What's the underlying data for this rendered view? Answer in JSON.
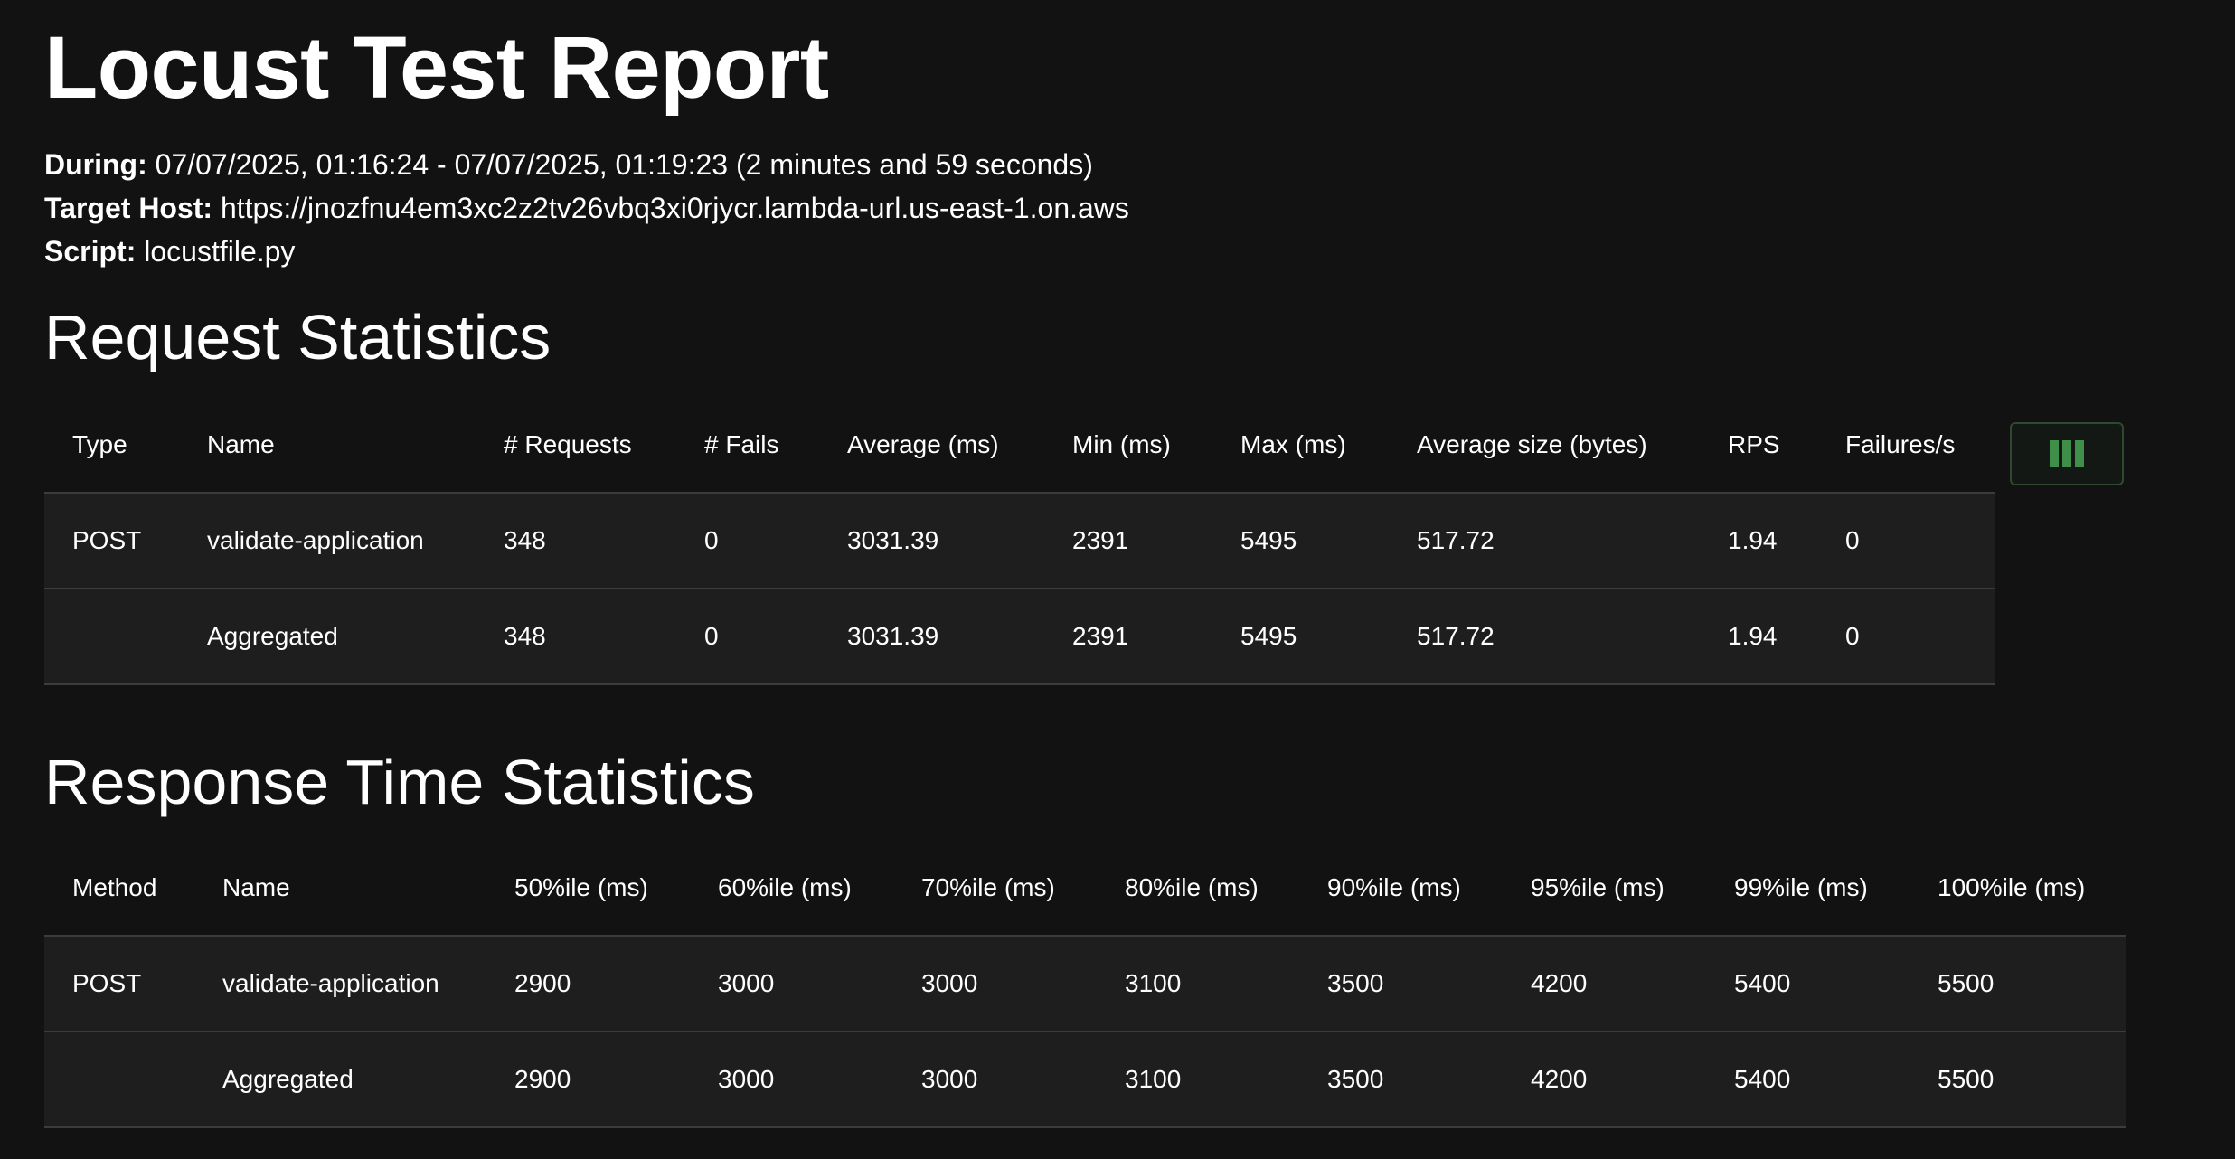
{
  "title": "Locust Test Report",
  "meta": {
    "during_label": "During:",
    "during_value": "07/07/2025, 01:16:24 - 07/07/2025, 01:19:23 (2 minutes and 59 seconds)",
    "host_label": "Target Host:",
    "host_value": "https://jnozfnu4em3xc2z2tv26vbq3xi0rjycr.lambda-url.us-east-1.on.aws",
    "script_label": "Script:",
    "script_value": "locustfile.py"
  },
  "request_statistics": {
    "title": "Request Statistics",
    "columns": [
      "Type",
      "Name",
      "# Requests",
      "# Fails",
      "Average (ms)",
      "Min (ms)",
      "Max (ms)",
      "Average size (bytes)",
      "RPS",
      "Failures/s"
    ],
    "rows": [
      [
        "POST",
        "validate-application",
        "348",
        "0",
        "3031.39",
        "2391",
        "5495",
        "517.72",
        "1.94",
        "0"
      ],
      [
        "",
        "Aggregated",
        "348",
        "0",
        "3031.39",
        "2391",
        "5495",
        "517.72",
        "1.94",
        "0"
      ]
    ],
    "column_toggle_icon": "columns-icon",
    "accent_color": "#3f8f4a"
  },
  "response_time_statistics": {
    "title": "Response Time Statistics",
    "columns": [
      "Method",
      "Name",
      "50%ile (ms)",
      "60%ile (ms)",
      "70%ile (ms)",
      "80%ile (ms)",
      "90%ile (ms)",
      "95%ile (ms)",
      "99%ile (ms)",
      "100%ile (ms)"
    ],
    "rows": [
      [
        "POST",
        "validate-application",
        "2900",
        "3000",
        "3000",
        "3100",
        "3500",
        "4200",
        "5400",
        "5500"
      ],
      [
        "",
        "Aggregated",
        "2900",
        "3000",
        "3000",
        "3100",
        "3500",
        "4200",
        "5400",
        "5500"
      ]
    ]
  }
}
